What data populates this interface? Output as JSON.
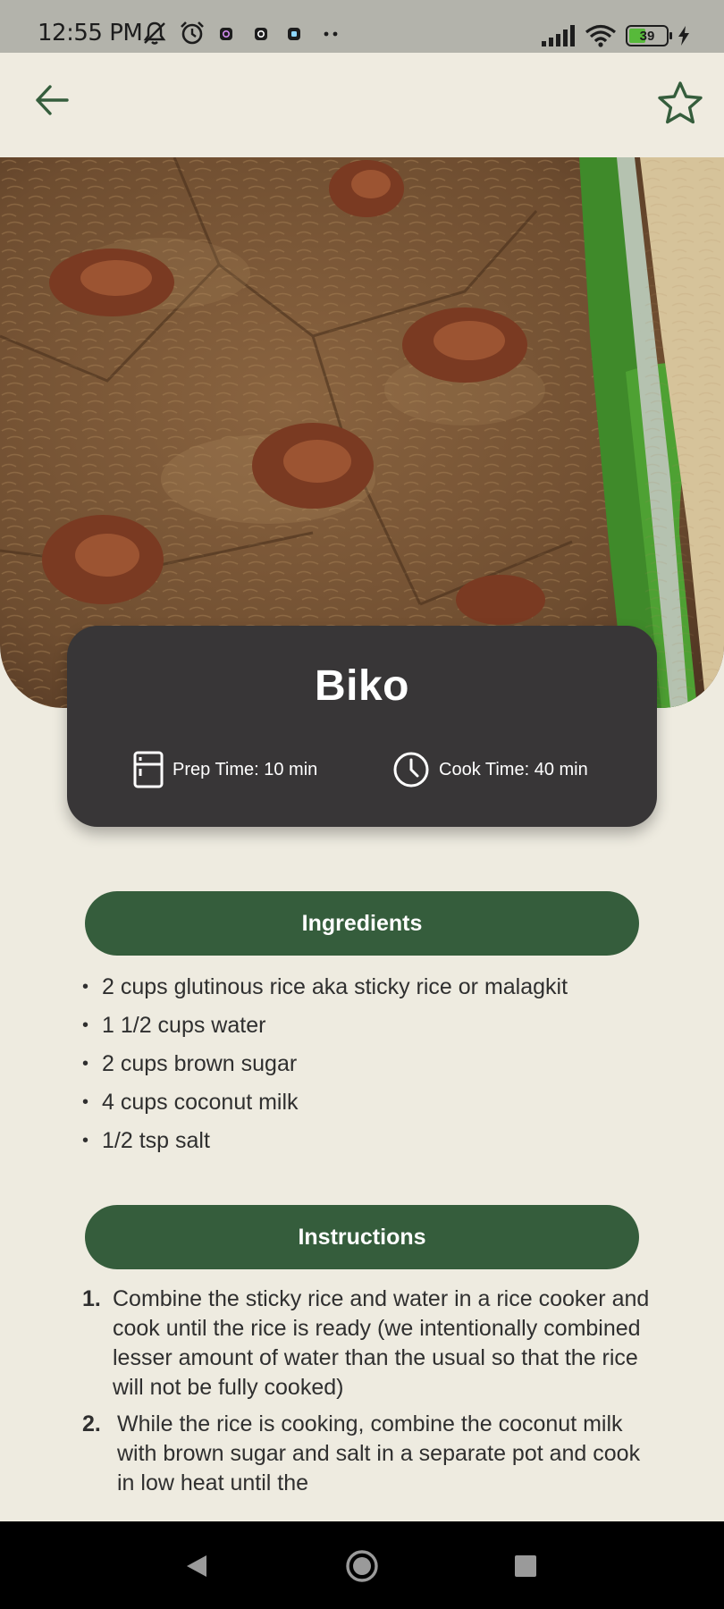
{
  "status_bar": {
    "time": "12:55 PM",
    "battery": "39",
    "icons": [
      "mute-icon",
      "alarm-icon",
      "notification-icon",
      "notification-icon",
      "notification-icon",
      "more-dots-icon",
      "signal-icon",
      "wifi-icon",
      "battery-icon",
      "charging-icon"
    ]
  },
  "app_bar": {
    "back_icon": "arrow-left-icon",
    "favorite_icon": "star-outline-icon"
  },
  "recipe": {
    "title": "Biko",
    "prep_time": "Prep Time: 10 min",
    "cook_time": "Cook Time: 40 min",
    "prep_icon": "fridge-icon",
    "cook_icon": "clock-icon"
  },
  "ingredients": {
    "label": "Ingredients",
    "items": [
      "2 cups glutinous rice aka sticky rice or malagkit",
      "1 1/2 cups water",
      "2 cups brown sugar",
      "4 cups coconut milk",
      "1/2 tsp salt"
    ]
  },
  "instructions": {
    "label": "Instructions",
    "steps": [
      {
        "num": "1.",
        "text": "Combine the sticky rice and water in a rice cooker and cook until the rice is ready (we intentionally combined lesser amount of water than the usual so that the rice will not be fully cooked)"
      },
      {
        "num": "2.",
        "text": "While the rice is cooking, combine the coconut milk with brown sugar and salt in a separate pot and cook in low heat until the"
      }
    ]
  },
  "nav_bar": {
    "icons": [
      "back-triangle-icon",
      "home-circle-icon",
      "recents-square-icon"
    ]
  },
  "colors": {
    "accent": "#355d3c",
    "card": "#383637",
    "background": "#eeebe0",
    "status_bar": "#b3b3ab"
  }
}
